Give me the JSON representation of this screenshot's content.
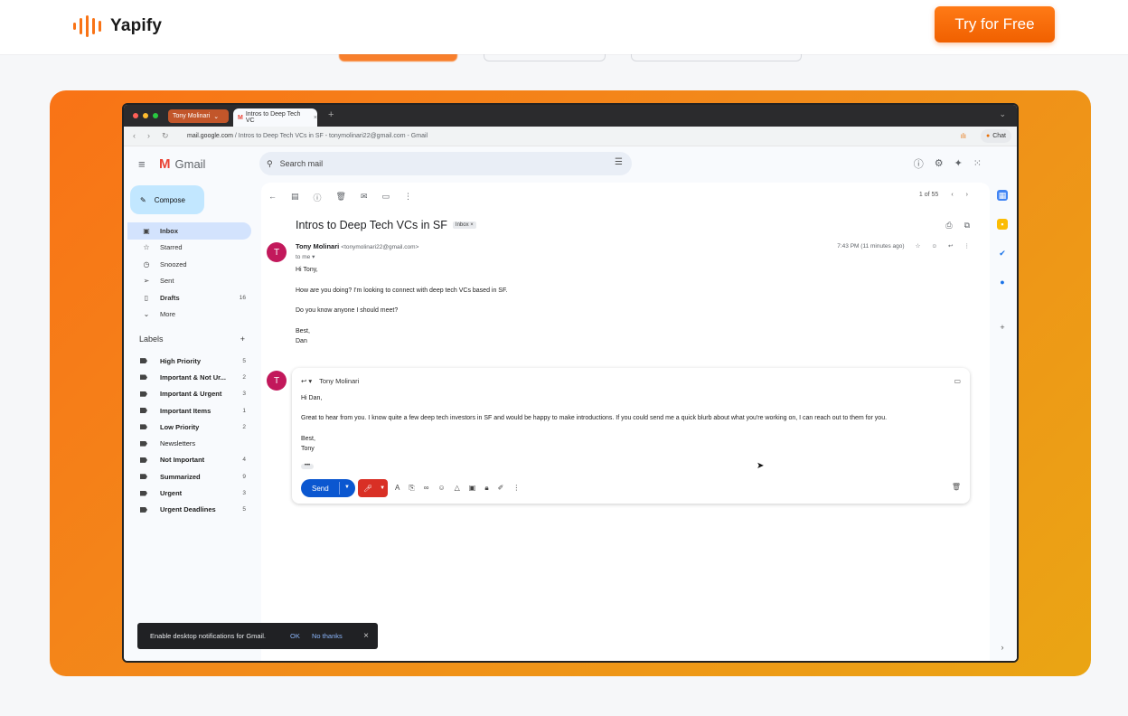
{
  "site": {
    "brand_name": "Yapify",
    "cta_label": "Try for Free",
    "accent": "#f97316"
  },
  "browser": {
    "profile_tab": "Tony Molinari",
    "tab_title": "Intros to Deep Tech VC",
    "url_domain": "mail.google.com",
    "url_rest": "/ Intros to Deep Tech VCs in SF - tonymolinari22@gmail.com - Gmail",
    "chat_label": "Chat"
  },
  "gmail": {
    "logo_text": "Gmail",
    "search_placeholder": "Search mail",
    "compose_label": "Compose",
    "nav": [
      {
        "label": "Inbox",
        "count": "",
        "icon": "inbox-icon",
        "glyph": "▣"
      },
      {
        "label": "Starred",
        "count": "",
        "icon": "star-icon",
        "glyph": "☆"
      },
      {
        "label": "Snoozed",
        "count": "",
        "icon": "clock-icon",
        "glyph": "◷"
      },
      {
        "label": "Sent",
        "count": "",
        "icon": "send-icon",
        "glyph": "➢"
      },
      {
        "label": "Drafts",
        "count": "16",
        "icon": "draft-icon",
        "glyph": "▯"
      },
      {
        "label": "More",
        "count": "",
        "icon": "chevron-down-icon",
        "glyph": "⌄"
      }
    ],
    "labels_heading": "Labels",
    "labels": [
      {
        "label": "High Priority",
        "count": "5",
        "bold": true
      },
      {
        "label": "Important & Not Ur...",
        "count": "2",
        "bold": true
      },
      {
        "label": "Important & Urgent",
        "count": "3",
        "bold": true
      },
      {
        "label": "Important Items",
        "count": "1",
        "bold": true
      },
      {
        "label": "Low Priority",
        "count": "2",
        "bold": true
      },
      {
        "label": "Newsletters",
        "count": "",
        "bold": false
      },
      {
        "label": "Not Important",
        "count": "4",
        "bold": true
      },
      {
        "label": "Summarized",
        "count": "9",
        "bold": true
      },
      {
        "label": "Urgent",
        "count": "3",
        "bold": true
      },
      {
        "label": "Urgent Deadlines",
        "count": "5",
        "bold": true
      }
    ],
    "pager": "1 of 55",
    "subject": "Intros to Deep Tech VCs in SF",
    "subject_badge": "Inbox ×",
    "avatar_letter": "T",
    "message": {
      "sender_name": "Tony Molinari",
      "sender_email": "<tonymolinari22@gmail.com>",
      "to": "to me",
      "time": "7:43 PM (11 minutes ago)",
      "lines": [
        "Hi Tony,",
        "How are you doing? I'm looking to connect with deep tech VCs based in SF.",
        "Do you know anyone I should meet?",
        "Best,",
        "Dan"
      ]
    },
    "reply": {
      "to_name": "Tony Molinari",
      "lines": [
        "Hi Dan,",
        "Great to hear from you. I know quite a few deep tech investors in SF and would be happy to make introductions. If you could send me a quick blurb about what you're working on, I can reach out to them for you.",
        "Best,",
        "Tony"
      ],
      "send_label": "Send"
    },
    "snackbar": {
      "text": "Enable desktop notifications for Gmail.",
      "ok": "OK",
      "no_thanks": "No thanks"
    }
  }
}
